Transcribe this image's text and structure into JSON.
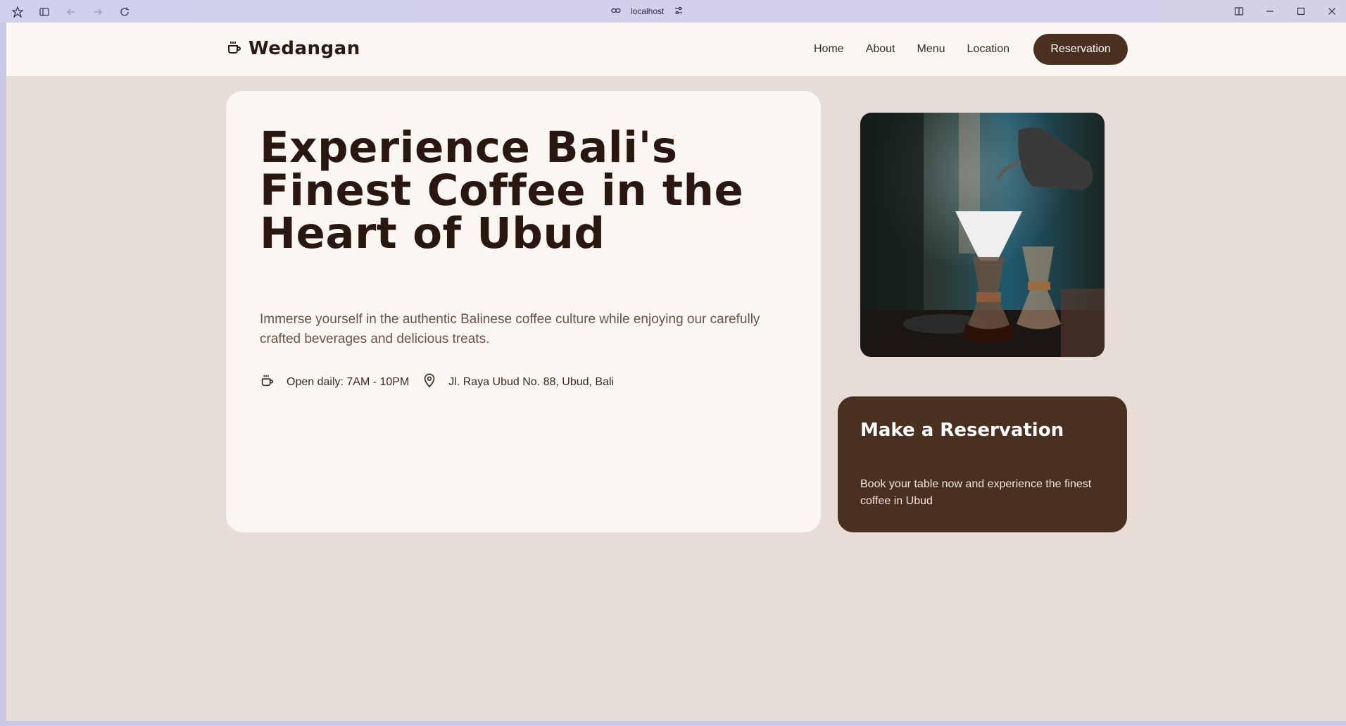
{
  "browser": {
    "address": "localhost"
  },
  "nav": {
    "brand": "Wedangan",
    "links": [
      "Home",
      "About",
      "Menu",
      "Location"
    ],
    "cta": "Reservation"
  },
  "hero": {
    "title": "Experience Bali's Finest Coffee in the Heart of Ubud",
    "subtitle": "Immerse yourself in the authentic Balinese coffee culture while enjoying our carefully crafted beverages and delicious treats.",
    "hours": "Open daily: 7AM - 10PM",
    "address": "Jl. Raya Ubud No. 88, Ubud, Bali"
  },
  "reservation_card": {
    "title": "Make a Reservation",
    "text": "Book your table now and experience the finest coffee in Ubud"
  },
  "colors": {
    "primary": "#4a3020",
    "background": "#e8ddd6",
    "card": "#faf6f2",
    "text_dark": "#2a1810"
  }
}
